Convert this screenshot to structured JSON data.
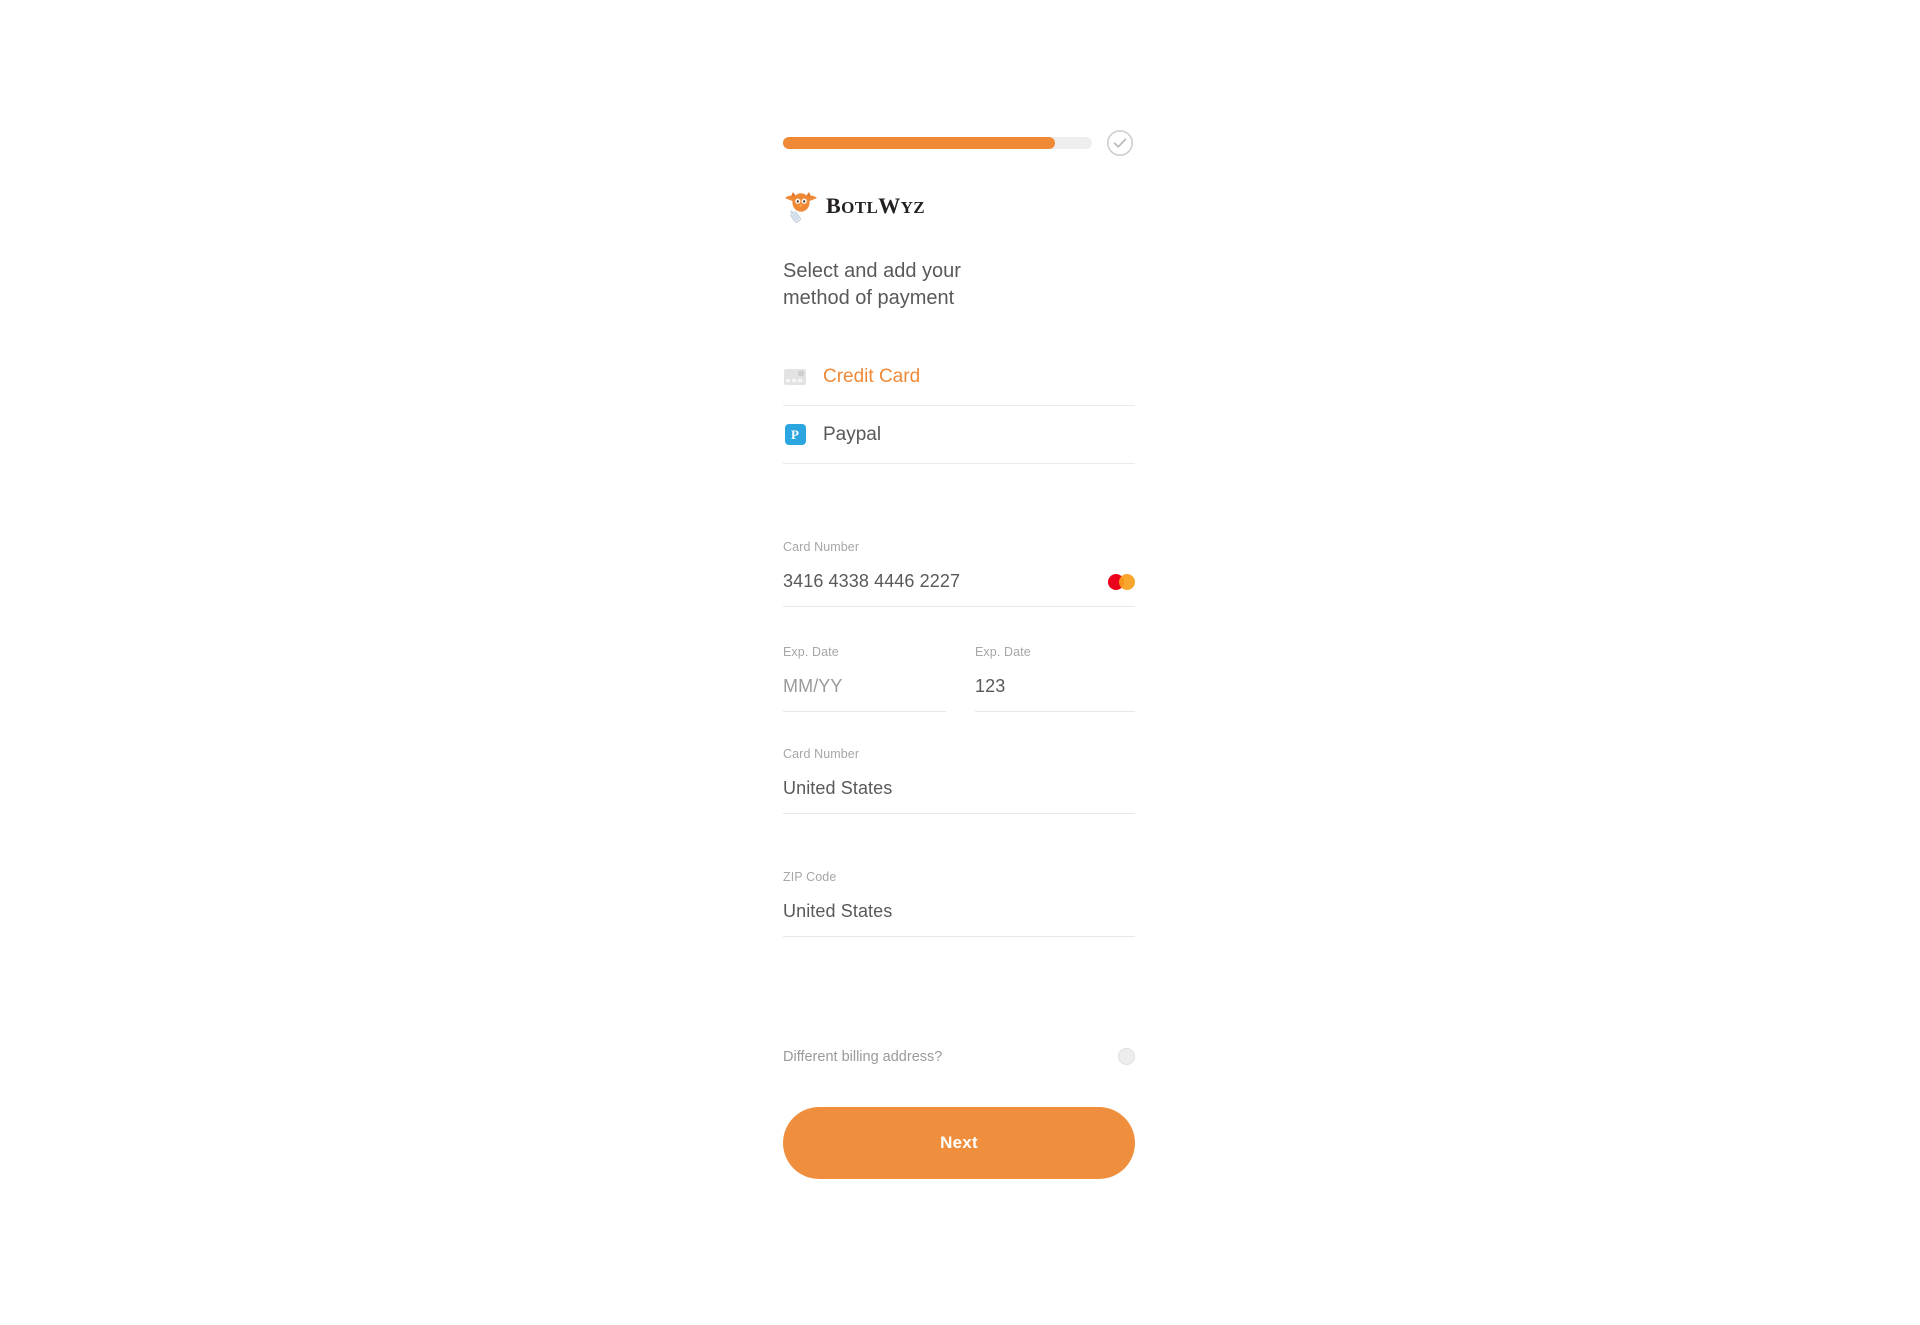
{
  "brand": {
    "name": "BotlWyz",
    "name_display_caps": "B",
    "logo_icon": "owl-with-bottle-logo",
    "accent_color": "#f08936",
    "text_color": "#58595b"
  },
  "progress": {
    "percent": 88,
    "fill_color": "#f08936",
    "track_color": "#eeeeee",
    "check_icon": "check-circle-icon"
  },
  "heading": {
    "line1": "Select and add your",
    "line2": "method of payment"
  },
  "payment_methods": [
    {
      "id": "credit-card",
      "label": "Credit Card",
      "icon": "credit-card-icon",
      "selected": true
    },
    {
      "id": "paypal",
      "label": "Paypal",
      "icon": "paypal-icon",
      "icon_glyph": "P",
      "selected": false
    }
  ],
  "form": {
    "card_number": {
      "label": "Card Number",
      "value": "3416 4338 4446 2227",
      "brand_icon": "mastercard-icon",
      "brand_colors": [
        "#eb001b",
        "#f79e1b"
      ]
    },
    "exp_date": {
      "label": "Exp. Date",
      "value": "MM/YY",
      "is_placeholder": true
    },
    "cvv": {
      "label": "Exp. Date",
      "value": "123",
      "is_placeholder": false
    },
    "country": {
      "label": "Card Number",
      "value": "United States"
    },
    "zip": {
      "label": "ZIP Code",
      "value": "United States"
    },
    "billing": {
      "label": "Different billing address?",
      "toggle_state": "off"
    }
  },
  "actions": {
    "next_label": "Next",
    "next_color": "#ef8f3e"
  }
}
